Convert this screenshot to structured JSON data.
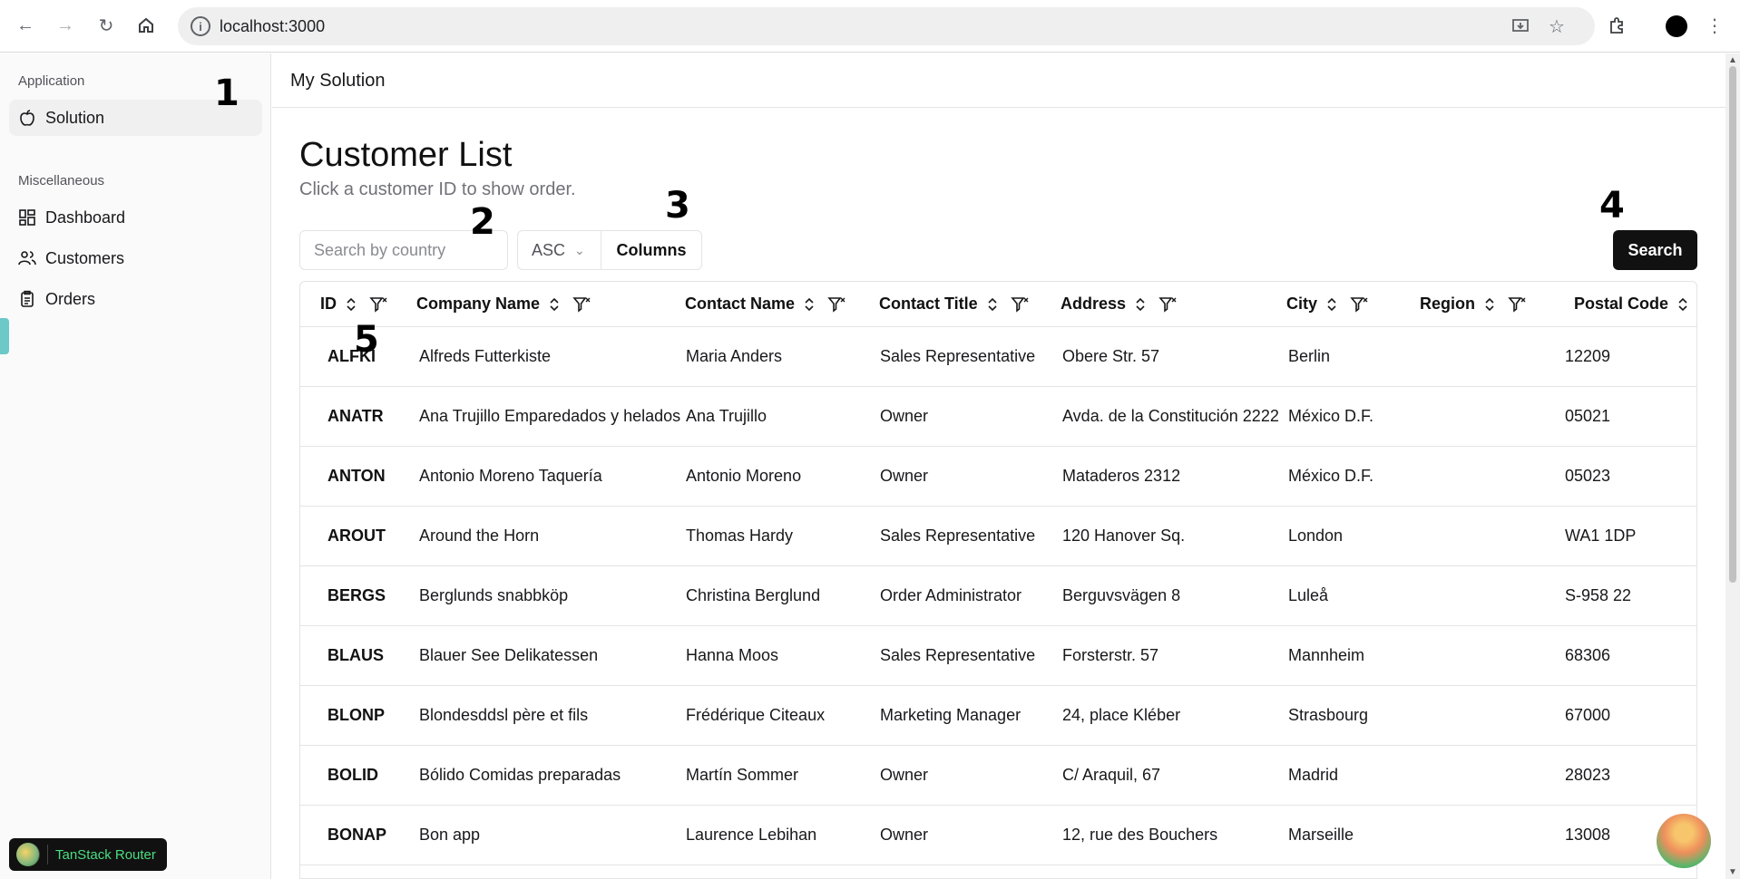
{
  "browser": {
    "url": "localhost:3000"
  },
  "sidebar": {
    "group1": "Application",
    "items1": [
      {
        "label": "Solution"
      }
    ],
    "group2": "Miscellaneous",
    "items2": [
      {
        "label": "Dashboard"
      },
      {
        "label": "Customers"
      },
      {
        "label": "Orders"
      }
    ],
    "badge": "TanStack Router"
  },
  "header": {
    "title": "My Solution"
  },
  "page": {
    "title": "Customer List",
    "subtitle": "Click a customer ID to show order."
  },
  "controls": {
    "search_placeholder": "Search by country",
    "sort_value": "ASC",
    "columns_label": "Columns",
    "search_label": "Search"
  },
  "table": {
    "columns": [
      "ID",
      "Company Name",
      "Contact Name",
      "Contact Title",
      "Address",
      "City",
      "Region",
      "Postal Code"
    ],
    "rows": [
      [
        "ALFKI",
        "Alfreds Futterkiste",
        "Maria Anders",
        "Sales Representative",
        "Obere Str. 57",
        "Berlin",
        "",
        "12209"
      ],
      [
        "ANATR",
        "Ana Trujillo Emparedados y helados",
        "Ana Trujillo",
        "Owner",
        "Avda. de la Constitución 2222",
        "México D.F.",
        "",
        "05021"
      ],
      [
        "ANTON",
        "Antonio Moreno Taquería",
        "Antonio Moreno",
        "Owner",
        "Mataderos 2312",
        "México D.F.",
        "",
        "05023"
      ],
      [
        "AROUT",
        "Around the Horn",
        "Thomas Hardy",
        "Sales Representative",
        "120 Hanover Sq.",
        "London",
        "",
        "WA1 1DP"
      ],
      [
        "BERGS",
        "Berglunds snabbköp",
        "Christina Berglund",
        "Order Administrator",
        "Berguvsvägen 8",
        "Luleå",
        "",
        "S-958 22"
      ],
      [
        "BLAUS",
        "Blauer See Delikatessen",
        "Hanna Moos",
        "Sales Representative",
        "Forsterstr. 57",
        "Mannheim",
        "",
        "68306"
      ],
      [
        "BLONP",
        "Blondesddsl père et fils",
        "Frédérique Citeaux",
        "Marketing Manager",
        "24, place Kléber",
        "Strasbourg",
        "",
        "67000"
      ],
      [
        "BOLID",
        "Bólido Comidas preparadas",
        "Martín Sommer",
        "Owner",
        "C/ Araquil, 67",
        "Madrid",
        "",
        "28023"
      ],
      [
        "BONAP",
        "Bon app",
        "Laurence Lebihan",
        "Owner",
        "12, rue des Bouchers",
        "Marseille",
        "",
        "13008"
      ]
    ]
  },
  "annotations": [
    "1",
    "2",
    "3",
    "4",
    "5"
  ]
}
